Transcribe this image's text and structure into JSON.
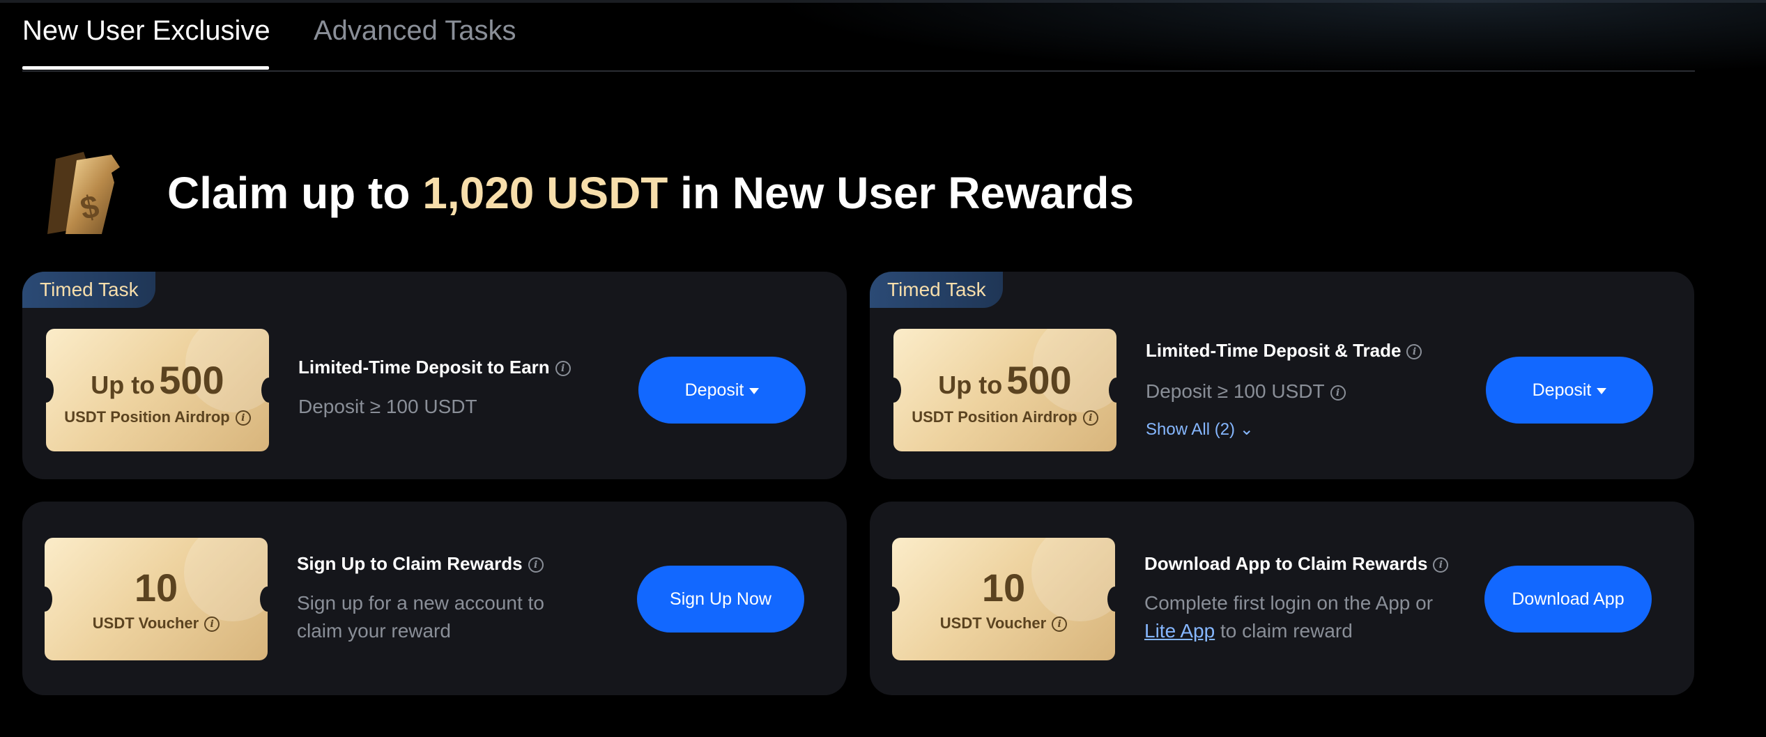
{
  "tabs": [
    {
      "label": "New User Exclusive",
      "active": true
    },
    {
      "label": "Advanced Tasks",
      "active": false
    }
  ],
  "hero": {
    "prefix": "Claim up to",
    "amount": "1,020 USDT",
    "suffix": "in New User Rewards",
    "icon": "gold-ticket-icon"
  },
  "cards": [
    {
      "badge": "Timed Task",
      "ticket_prefix": "Up to",
      "ticket_amount": "500",
      "ticket_label": "USDT Position Airdrop",
      "title": "Limited-Time Deposit to Earn",
      "desc": "Deposit ≥ 100 USDT",
      "button": "Deposit"
    },
    {
      "badge": "Timed Task",
      "ticket_prefix": "Up to",
      "ticket_amount": "500",
      "ticket_label": "USDT Position Airdrop",
      "title": "Limited-Time Deposit & Trade",
      "desc": "Deposit ≥ 100 USDT",
      "show_all": "Show All (2)",
      "button": "Deposit"
    },
    {
      "ticket_amount": "10",
      "ticket_label": "USDT Voucher",
      "title": "Sign Up to Claim Rewards",
      "desc_line1": "Sign up for a new account to",
      "desc_line2": "claim your reward",
      "button": "Sign Up Now"
    },
    {
      "ticket_amount": "10",
      "ticket_label": "USDT Voucher",
      "title": "Download App to Claim Rewards",
      "desc_line1": "Complete first login on the App or",
      "link": "Lite App",
      "desc_line2_suffix": "to claim reward",
      "button": "Download App"
    }
  ],
  "colors": {
    "background": "#000000",
    "card": "#15161b",
    "accent_gold": "#f7deab",
    "button_blue": "#1268ff",
    "muted_text": "#8a8f98",
    "link": "#86b7ff"
  }
}
